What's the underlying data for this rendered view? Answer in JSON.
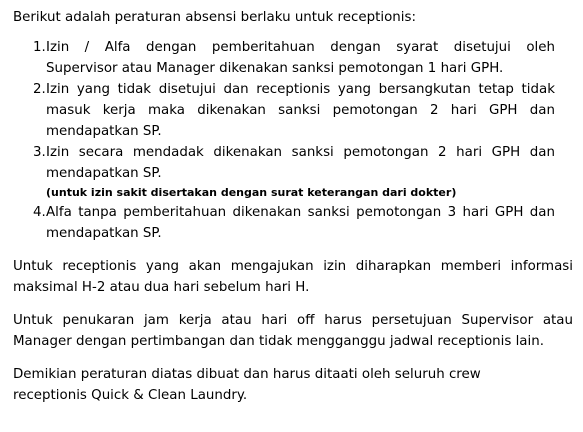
{
  "intro": "Berikut adalah peraturan absensi berlaku untuk receptionis:",
  "rules": [
    {
      "number": "1.",
      "lines": [
        "Izin / Alfa dengan pemberitahuan dengan syarat disetujui oleh",
        "Supervisor atau Manager dikenakan sanksi pemotongan 1 hari GPH."
      ]
    },
    {
      "number": "2.",
      "lines": [
        "Izin yang tidak disetujui  dan receptionis yang bersangkutan tetap tidak",
        "masuk kerja maka dikenakan sanksi pemotongan 2 hari GPH dan",
        "mendapatkan SP."
      ]
    },
    {
      "number": "3.",
      "lines": [
        "Izin secara mendadak dikenakan sanksi pemotongan 2 hari GPH dan",
        "mendapatkan SP."
      ],
      "note": "(untuk izin sakit disertakan dengan surat keterangan dari dokter)"
    },
    {
      "number": "4.",
      "lines": [
        "Alfa tanpa pemberitahuan dikenakan sanksi pemotongan 3 hari GPH dan",
        "mendapatkan SP."
      ]
    }
  ],
  "paragraphs": [
    {
      "lines": [
        "Untuk receptionis yang akan mengajukan izin diharapkan memberi informasi",
        "maksimal H-2 atau dua hari sebelum hari H."
      ]
    },
    {
      "lines": [
        "Untuk penukaran jam kerja atau hari off harus persetujuan Supervisor atau",
        "Manager dengan pertimbangan dan tidak mengganggu jadwal receptionis lain."
      ]
    },
    {
      "lines": [
        "Demikian peraturan diatas dibuat dan harus ditaati oleh seluruh crew",
        "receptionis Quick & Clean Laundry."
      ]
    }
  ]
}
